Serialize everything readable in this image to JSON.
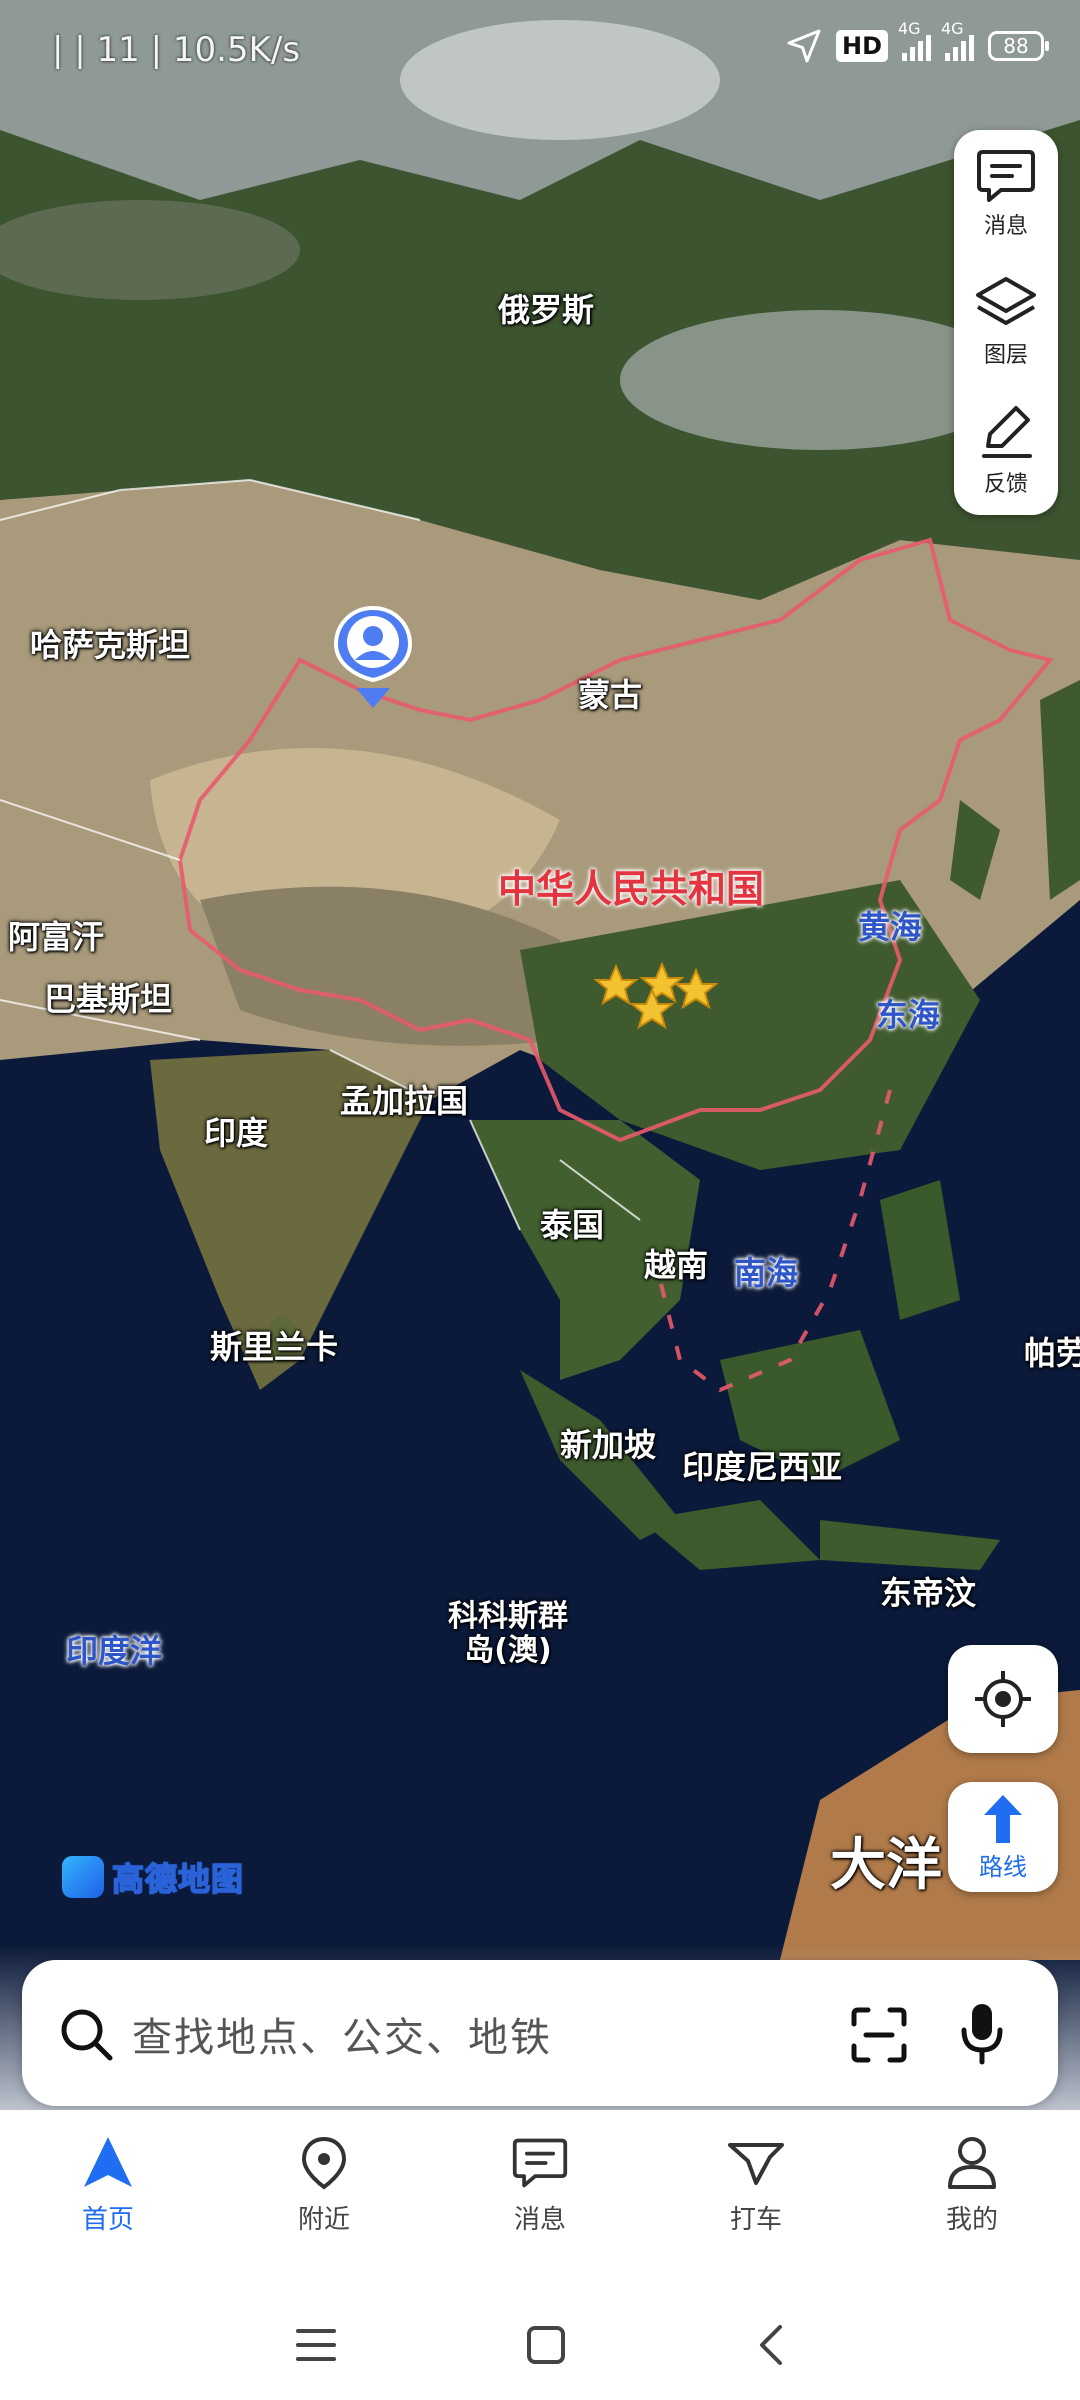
{
  "status_bar": {
    "left_text": "| | 11 | 10.5K/s",
    "hd_badge": "HD",
    "net1": "4G",
    "net2": "4G",
    "battery": "88"
  },
  "map": {
    "labels": {
      "russia": "俄罗斯",
      "kazakhstan": "哈萨克斯坦",
      "mongolia": "蒙古",
      "china": "中华人民共和国",
      "afghanistan": "阿富汗",
      "pakistan": "巴基斯坦",
      "india": "印度",
      "bangladesh": "孟加拉国",
      "thailand": "泰国",
      "vietnam": "越南",
      "sri_lanka": "斯里兰卡",
      "singapore": "新加坡",
      "indonesia": "印度尼西亚",
      "east_timor": "东帝汶",
      "cocos": "科科斯群\n岛(澳)",
      "oceania": "大洋",
      "palau": "帕劳"
    },
    "seas": {
      "yellow_sea": "黄海",
      "east_sea": "东海",
      "south_sea": "南海",
      "indian_ocean": "印度洋"
    }
  },
  "tools": {
    "message": "消息",
    "layers": "图层",
    "feedback": "反馈"
  },
  "route_button": "路线",
  "logo_text": "高德地图",
  "search": {
    "placeholder": "查找地点、公交、地铁"
  },
  "tabs": [
    {
      "label": "首页",
      "icon": "navigation-arrow-icon"
    },
    {
      "label": "附近",
      "icon": "location-pin-icon"
    },
    {
      "label": "消息",
      "icon": "message-icon"
    },
    {
      "label": "打车",
      "icon": "taxi-icon"
    },
    {
      "label": "我的",
      "icon": "user-icon"
    }
  ],
  "colors": {
    "accent": "#1f6df0",
    "border_red": "#e4343f",
    "sea_label": "#2f56c9"
  }
}
